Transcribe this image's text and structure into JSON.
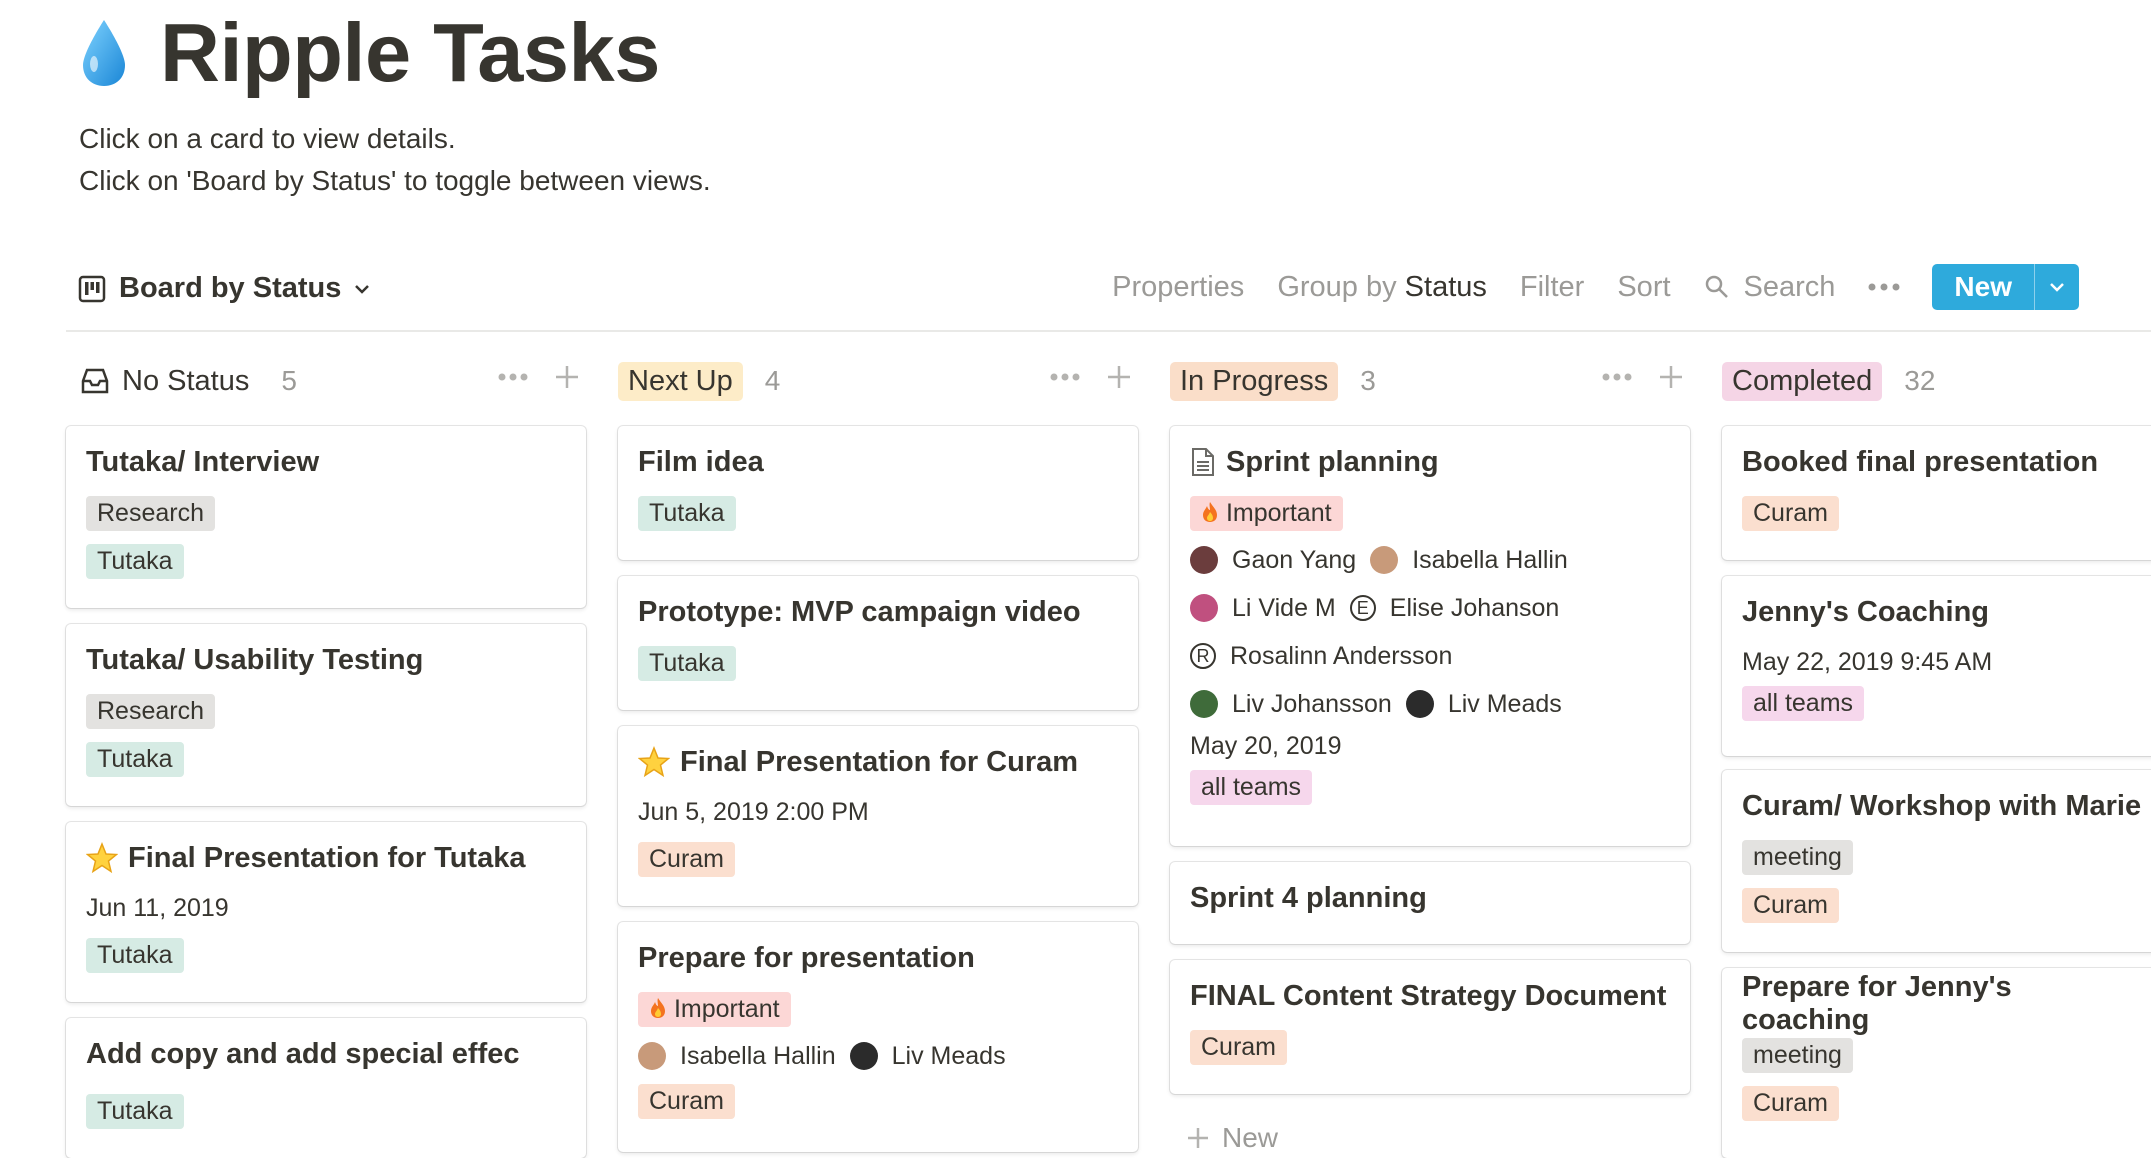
{
  "page": {
    "title": "Ripple Tasks",
    "description": [
      "Click on a card to view details.",
      "Click on 'Board by Status' to toggle between views."
    ]
  },
  "toolbar": {
    "view_label": "Board by Status",
    "properties": "Properties",
    "group_by_prefix": "Group by",
    "group_by_value": "Status",
    "filter": "Filter",
    "sort": "Sort",
    "search": "Search",
    "new_label": "New",
    "accent": "#2eaadc"
  },
  "columns": [
    {
      "label": "No Status",
      "count": "5",
      "cards": [
        {
          "title": "Tutaka/ Interview",
          "tags": [
            "Research",
            "Tutaka"
          ]
        },
        {
          "title": "Tutaka/ Usability Testing",
          "tags": [
            "Research",
            "Tutaka"
          ]
        },
        {
          "title": "Final Presentation for Tutaka",
          "date": "Jun 11, 2019",
          "tags": [
            "Tutaka"
          ]
        },
        {
          "title": "Add copy and add special effec",
          "tags": [
            "Tutaka"
          ]
        }
      ]
    },
    {
      "label": "Next Up",
      "count": "4",
      "cards": [
        {
          "title": "Film idea",
          "tags": [
            "Tutaka"
          ]
        },
        {
          "title": "Prototype: MVP campaign video",
          "tags": [
            "Tutaka"
          ]
        },
        {
          "title": "Final Presentation for Curam",
          "date": "Jun 5, 2019 2:00 PM",
          "tags": [
            "Curam"
          ]
        },
        {
          "title": "Prepare for presentation",
          "priority": "Important",
          "people": [
            "Isabella Hallin",
            "Liv Meads"
          ],
          "tags": [
            "Curam"
          ]
        }
      ]
    },
    {
      "label": "In Progress",
      "count": "3",
      "cards": [
        {
          "title": "Sprint planning",
          "priority": "Important",
          "people": [
            "Gaon Yang",
            "Isabella Hallin",
            "Li Vide M",
            "Elise Johanson",
            "Rosalinn Andersson",
            "Liv Johansson",
            "Liv Meads"
          ],
          "date": "May 20, 2019",
          "tags": [
            "all teams"
          ]
        },
        {
          "title": "Sprint 4 planning"
        },
        {
          "title": "FINAL Content Strategy Document",
          "tags": [
            "Curam"
          ]
        }
      ],
      "new_label": "New"
    },
    {
      "label": "Completed",
      "count": "32",
      "cards": [
        {
          "title": "Booked final presentation",
          "tags": [
            "Curam"
          ]
        },
        {
          "title": "Jenny's Coaching",
          "date": "May 22, 2019 9:45 AM",
          "tags": [
            "all teams"
          ]
        },
        {
          "title": "Curam/ Workshop with Marie",
          "tags": [
            "meeting",
            "Curam"
          ]
        },
        {
          "title": "Prepare for Jenny's coaching",
          "tags": [
            "meeting",
            "Curam"
          ]
        }
      ]
    }
  ],
  "colors": {
    "next_up": "#fdecc8",
    "in_progress": "#fadec9",
    "completed": "#f5e0e9",
    "tutaka": "#d6ebe4",
    "curam": "#fbdfcf",
    "research": "#e3e2e0",
    "all_teams": "#f6d7ec",
    "important": "#fcd7d6"
  }
}
